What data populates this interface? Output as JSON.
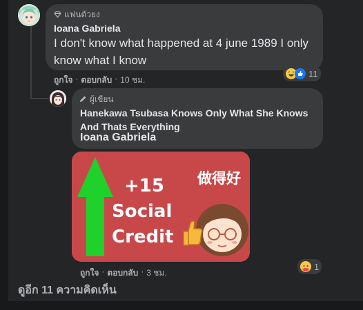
{
  "comment1": {
    "badge": "แฟนตัวยง",
    "author": "Ioana Gabriela",
    "text": "I don't know what happened at 4 june 1989 I only know what I know",
    "actions": {
      "like": "ถูกใจ",
      "reply": "ตอบกลับ",
      "time": "10 ชม."
    },
    "reactions": {
      "icons": [
        "haha-icon",
        "like-icon"
      ],
      "count": "11"
    }
  },
  "reply1": {
    "badge": "ผู้เขียน",
    "quoted_title": "Hanekawa Tsubasa Knows Only What She Knows And Thats Everything",
    "mention": "Ioana Gabriela",
    "sticker": {
      "line1": "+15",
      "line2": "Social",
      "line3": "Credit",
      "chinese": "做得好",
      "colors": {
        "background": "#c8484a",
        "arrow": "#1fd12a"
      }
    },
    "actions": {
      "like": "ถูกใจ",
      "reply": "ตอบกลับ",
      "time": "3 ชม."
    },
    "reactions": {
      "icons": [
        "care-icon"
      ],
      "count": "1"
    }
  },
  "footer": {
    "more_comments": "ดูอีก 11 ความคิดเห็น"
  },
  "colors": {
    "page": "#18191a",
    "panel": "#242526",
    "bubble": "#3a3b3c",
    "text": "#e4e6eb",
    "muted": "#b0b3b8"
  }
}
